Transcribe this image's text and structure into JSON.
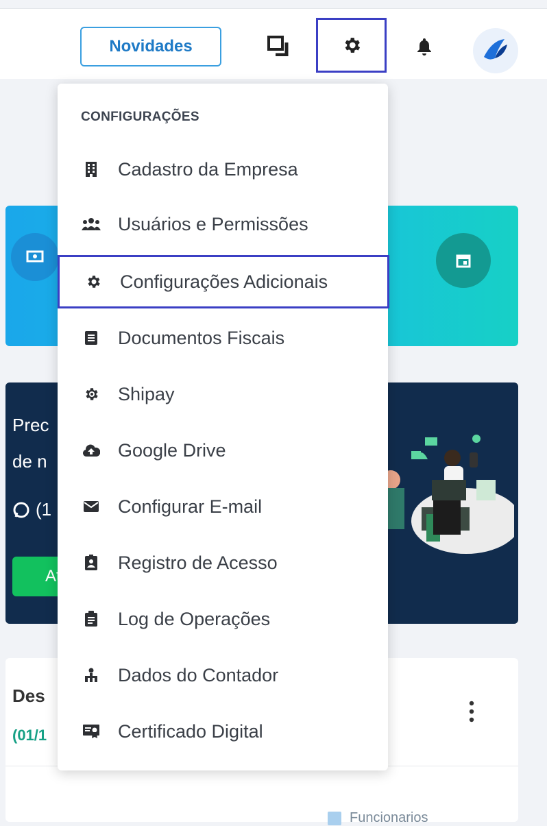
{
  "header": {
    "novidades_label": "Novidades",
    "icons": [
      "windows-icon",
      "gear-icon",
      "bell-icon",
      "avatar-logo"
    ]
  },
  "dropdown": {
    "header": "CONFIGURAÇÕES",
    "items": [
      {
        "label": "Cadastro da Empresa",
        "icon": "building-icon"
      },
      {
        "label": "Usuários e Permissões",
        "icon": "users-icon"
      },
      {
        "label": "Configurações Adicionais",
        "icon": "gear-icon",
        "highlighted": true
      },
      {
        "label": "Documentos Fiscais",
        "icon": "document-icon"
      },
      {
        "label": "Shipay",
        "icon": "shipay-gear-icon"
      },
      {
        "label": "Google Drive",
        "icon": "cloud-upload-icon"
      },
      {
        "label": "Configurar E-mail",
        "icon": "envelope-icon"
      },
      {
        "label": "Registro de Acesso",
        "icon": "id-badge-icon"
      },
      {
        "label": "Log de Operações",
        "icon": "clipboard-icon"
      },
      {
        "label": "Dados do Contador",
        "icon": "org-chart-icon"
      },
      {
        "label": "Certificado Digital",
        "icon": "certificate-icon"
      }
    ]
  },
  "background": {
    "dark_card": {
      "line1": "Prec",
      "line2": "de n",
      "whatsapp": "(1",
      "button": "At"
    },
    "white_card": {
      "title": "Des",
      "subtitle": "(01/1"
    },
    "legend": "Funcionarios"
  },
  "colors": {
    "accent": "#3b3fc4",
    "novidades_border": "#3a9fe0",
    "dark_card": "#112c4d",
    "green_button": "#12c15e"
  }
}
